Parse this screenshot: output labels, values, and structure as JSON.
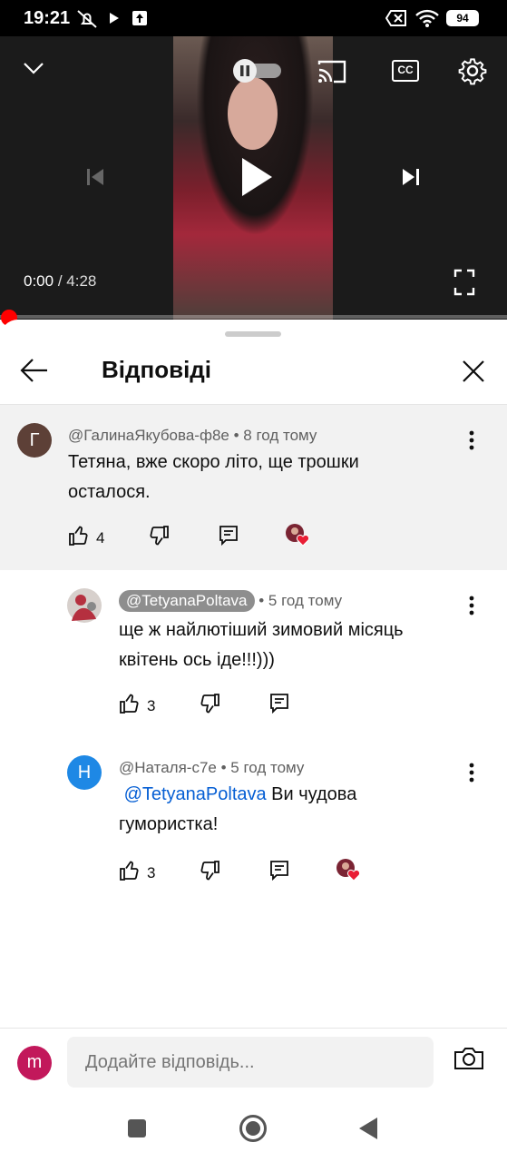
{
  "status_bar": {
    "time": "19:21",
    "battery": "94",
    "icons": [
      "mute-icon",
      "play-store-icon",
      "upload-icon",
      "dnd-icon",
      "wifi-icon",
      "battery-icon"
    ]
  },
  "player": {
    "current_time": "0:00",
    "separator": " / ",
    "duration": "4:28",
    "progress_fraction": 0.0,
    "cc_label": "CC",
    "icons": [
      "chevron-down-icon",
      "autoplay-toggle-icon",
      "cast-icon",
      "cc-icon",
      "settings-gear-icon",
      "previous-icon",
      "play-icon",
      "next-icon",
      "fullscreen-icon"
    ]
  },
  "sheet": {
    "title": "Відповіді"
  },
  "parent_comment": {
    "avatar_letter": "Г",
    "avatar_color": "#5d4037",
    "author": "@ГалинаЯкубова-ф8е",
    "time": " • 8 год тому",
    "text": "Тетяна, вже скоро літо, ще трошки осталося.",
    "likes": "4"
  },
  "replies": [
    {
      "author": "@TetyanaPoltava",
      "time": " • 5 год тому",
      "text": "ще ж найлютіший зимовий місяць квітень ось іде!!!)))",
      "likes": "3"
    },
    {
      "avatar_letter": "Н",
      "avatar_color": "#1e88e5",
      "author": "@Наталя-с7е",
      "time": " • 5 год тому",
      "mention": "@TetyanaPoltava",
      "text": " Ви чудова гумористка!",
      "likes": "3"
    }
  ],
  "reply_box": {
    "avatar_letter": "m",
    "avatar_color": "#c2185b",
    "placeholder": "Додайте відповідь..."
  },
  "accent": "#ff0000",
  "link_color": "#065fd4"
}
